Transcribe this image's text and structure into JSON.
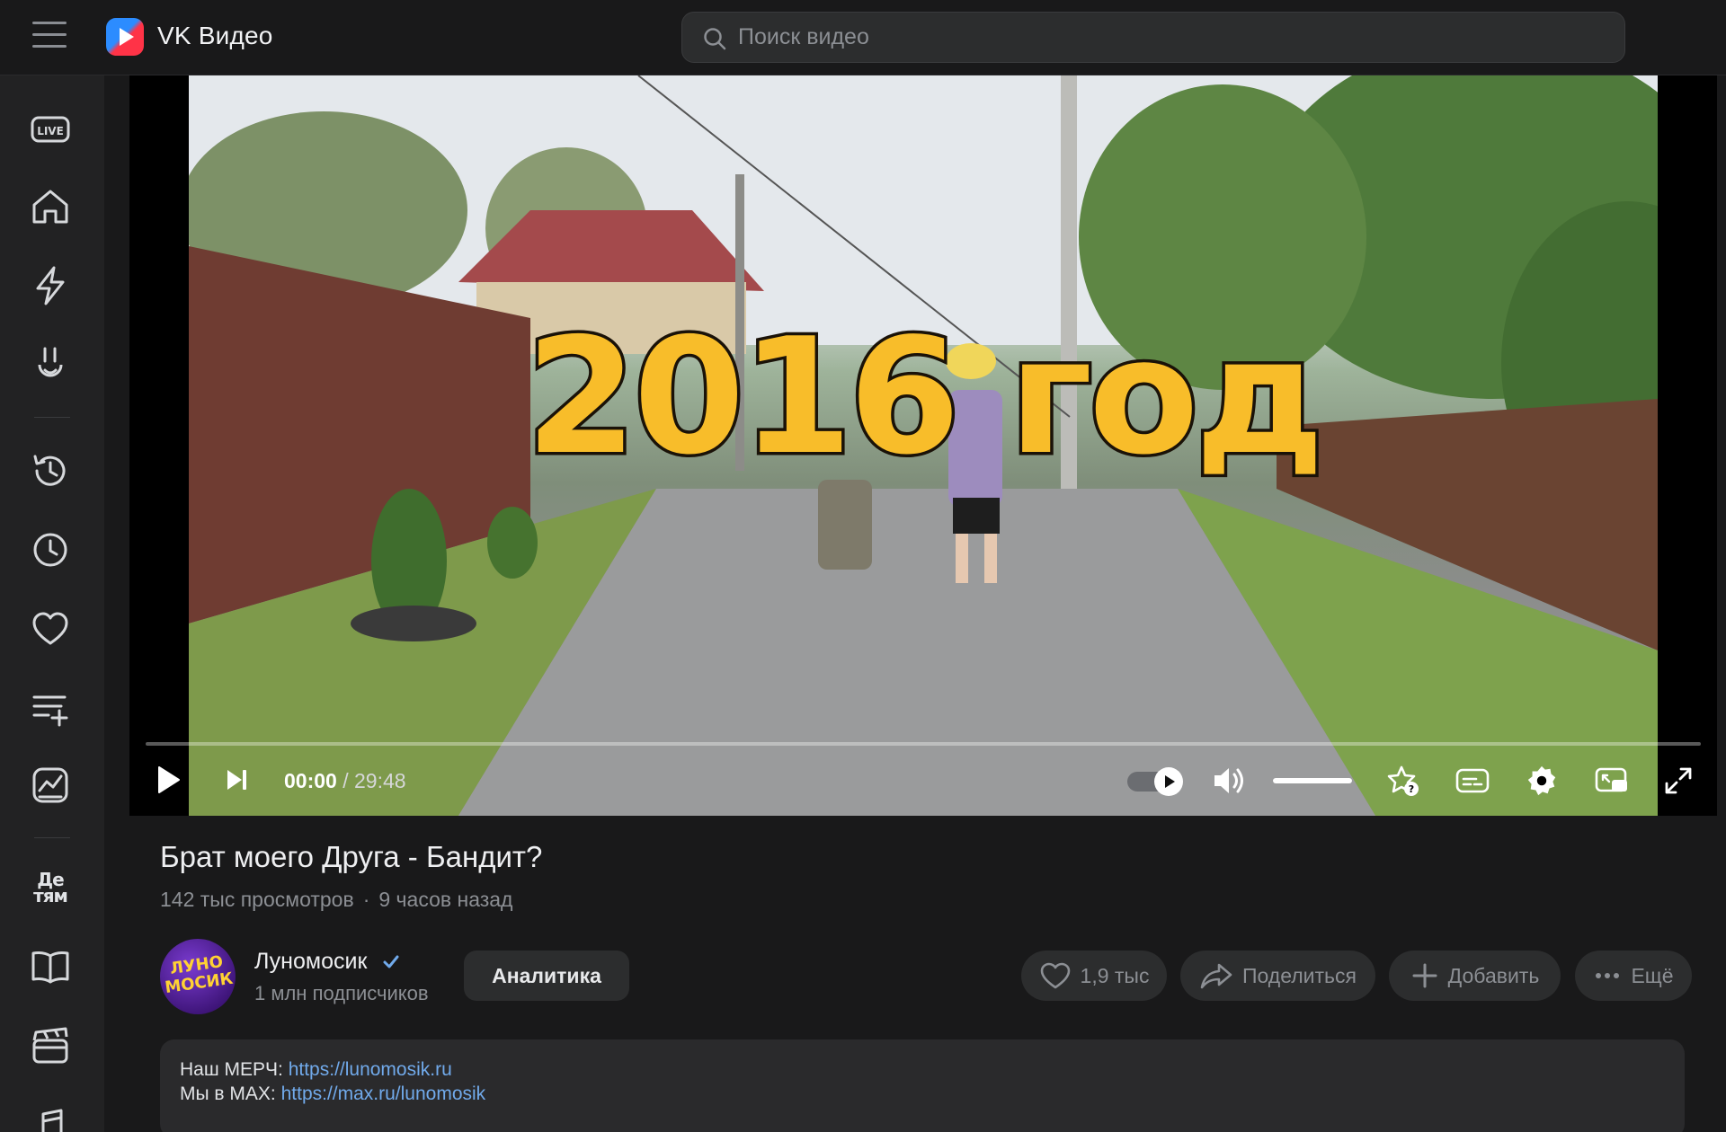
{
  "app": {
    "brand": "VK Видео"
  },
  "search": {
    "placeholder": "Поиск видео"
  },
  "sidebar": {
    "items": [
      {
        "name": "live",
        "icon": "live-icon"
      },
      {
        "name": "home",
        "icon": "home-icon"
      },
      {
        "name": "shorts",
        "icon": "lightning-icon"
      },
      {
        "name": "subscriptions",
        "icon": "subscriptions-icon"
      },
      {
        "name": "history",
        "icon": "history-icon"
      },
      {
        "name": "watch-later",
        "icon": "clock-icon"
      },
      {
        "name": "liked",
        "icon": "heart-icon"
      },
      {
        "name": "playlists",
        "icon": "playlist-add-icon"
      },
      {
        "name": "analytics",
        "icon": "chart-icon"
      },
      {
        "name": "kids",
        "label": "Де тям"
      },
      {
        "name": "catalog",
        "icon": "book-icon"
      },
      {
        "name": "movies",
        "icon": "clapper-icon"
      },
      {
        "name": "music",
        "icon": "music-icon"
      }
    ]
  },
  "player": {
    "overlay_text": "2016 год",
    "current_time": "00:00",
    "separator": " / ",
    "duration": "29:48",
    "progress": 0,
    "volume": 1.0,
    "autoplay": true
  },
  "video": {
    "title": "Брат моего Друга - Бандит?",
    "views": "142 тыс просмотров",
    "dot": "·",
    "published": "9 часов назад"
  },
  "channel": {
    "name": "Луномосик",
    "subscribers": "1 млн подписчиков",
    "avatar_text": "ЛУНО МОСИК",
    "verified": true
  },
  "actions": {
    "analytics": "Аналитика",
    "likes": "1,9 тыс",
    "share": "Поделиться",
    "add": "Добавить",
    "more": "Ещё"
  },
  "description": {
    "line1_label": "Наш МЕРЧ: ",
    "line1_link": "https://lunomosik.ru",
    "line2_label": "Мы в MAX: ",
    "line2_link": "https://max.ru/lunomosik"
  },
  "colors": {
    "background": "#19191a",
    "sidebar": "#222223",
    "accent_link": "#71aaeb",
    "overlay_yellow": "#f8bd2a",
    "verified_blue": "#71aaeb"
  }
}
